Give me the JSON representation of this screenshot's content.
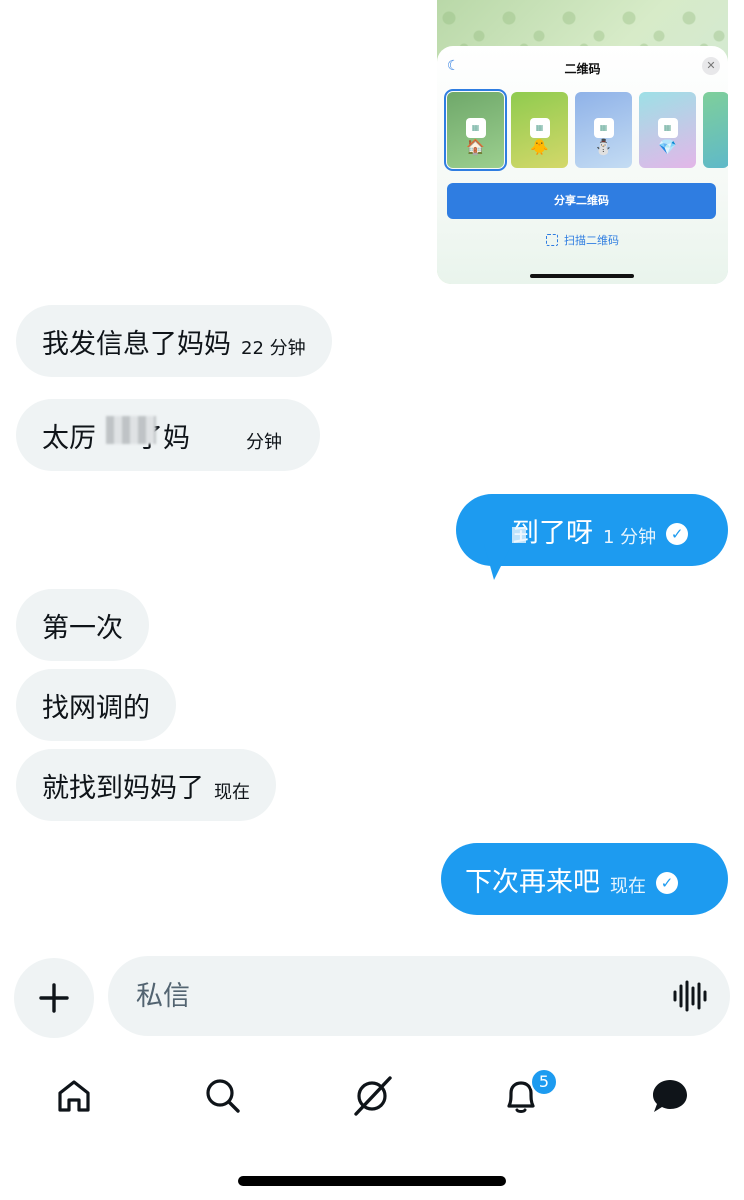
{
  "shared_image": {
    "sheet_title": "二维码",
    "share_button": "分享二维码",
    "scan_link": "扫描二维码",
    "theme_emojis": [
      "🏠",
      "🐥",
      "⛄",
      "💎",
      ""
    ]
  },
  "messages": [
    {
      "direction": "in",
      "text": "我发信息了妈妈",
      "time": "22 分钟"
    },
    {
      "direction": "in",
      "text": "太厉",
      "text_after": "了妈",
      "time": "分钟",
      "partially_obscured": true
    },
    {
      "direction": "out",
      "text": "到了呀",
      "time": "1 分钟",
      "partially_obscured": true
    },
    {
      "direction": "in",
      "text": "第一次",
      "time": ""
    },
    {
      "direction": "in",
      "text": "找网调的",
      "time": ""
    },
    {
      "direction": "in",
      "text": "就找到妈妈了",
      "time": "现在"
    },
    {
      "direction": "out",
      "text": "下次再来吧",
      "time": "现在"
    }
  ],
  "composer": {
    "placeholder": "私信"
  },
  "tabbar": {
    "notifications_badge": "5"
  },
  "colors": {
    "accent": "#1d9bf0",
    "incoming_bubble": "#eff3f4"
  }
}
